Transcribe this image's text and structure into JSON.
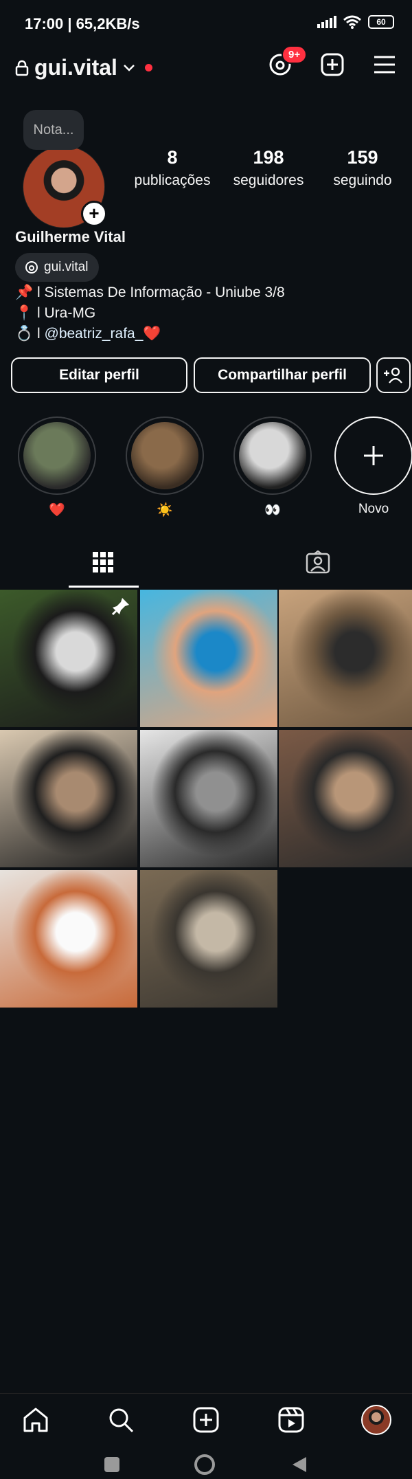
{
  "status_bar": {
    "time": "17:00 | 65,2KB/s",
    "battery": "60"
  },
  "header": {
    "username": "gui.vital",
    "threads_badge": "9+",
    "icons": [
      "lock-icon",
      "chevron-down-icon",
      "threads-icon",
      "add-post-icon",
      "menu-icon"
    ]
  },
  "profile": {
    "note_label": "Nota...",
    "full_name": "Guilherme Vital",
    "threads_handle": "gui.vital",
    "stats": [
      {
        "value": "8",
        "label": "publicações"
      },
      {
        "value": "198",
        "label": "seguidores"
      },
      {
        "value": "159",
        "label": "seguindo"
      }
    ],
    "bio_lines": [
      {
        "emoji": "📌",
        "text": " l Sistemas De Informação  - Uniube 3/8"
      },
      {
        "emoji": "📍",
        "text": " l Ura-MG"
      },
      {
        "emoji": "💍",
        "text": " l ",
        "mention": "@beatriz_rafa_",
        "after": "❤️"
      }
    ]
  },
  "actions": {
    "edit_profile": "Editar perfil",
    "share_profile": "Compartilhar perfil"
  },
  "highlights": [
    {
      "caption": "❤️",
      "colors": [
        "#6b7a5a",
        "#2b2b2b"
      ]
    },
    {
      "caption": "☀️",
      "colors": [
        "#8a6a4a",
        "#3a2d22"
      ]
    },
    {
      "caption": "👀",
      "colors": [
        "#d8d8d8",
        "#222222"
      ]
    },
    {
      "caption": "Novo",
      "new": true
    }
  ],
  "tabs": [
    "grid-icon",
    "tagged-icon"
  ],
  "grid_posts": [
    {
      "pinned": true,
      "colors": [
        "#3c5a2a",
        "#1b1b1b",
        "#d9d9d9"
      ]
    },
    {
      "pinned": false,
      "colors": [
        "#46b6e0",
        "#e0a47e",
        "#1b88c8"
      ]
    },
    {
      "pinned": false,
      "colors": [
        "#c7a27c",
        "#6e5840",
        "#2c2c2c"
      ]
    },
    {
      "pinned": false,
      "colors": [
        "#d9c8b0",
        "#1f1f1f",
        "#a88a70"
      ]
    },
    {
      "pinned": false,
      "colors": [
        "#e6e6e6",
        "#2a2a2a",
        "#909090"
      ]
    },
    {
      "pinned": false,
      "colors": [
        "#7b5a46",
        "#2a2a2a",
        "#b89678"
      ]
    },
    {
      "pinned": false,
      "colors": [
        "#e7e3de",
        "#c86a3a",
        "#fafafa"
      ]
    },
    {
      "pinned": false,
      "colors": [
        "#7a6a54",
        "#3a3630",
        "#c4b8a6"
      ]
    }
  ],
  "bottom_nav": [
    "home-icon",
    "search-icon",
    "create-icon",
    "reels-icon",
    "profile-avatar"
  ],
  "colors": {
    "background": "#0c1014",
    "accent_red": "#ff3040",
    "mention": "#e0f1ff"
  }
}
